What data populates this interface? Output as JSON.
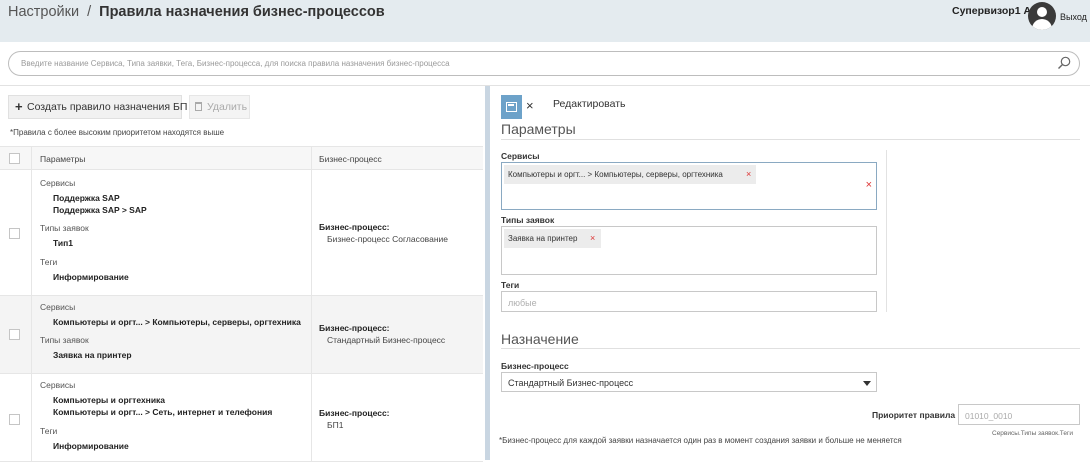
{
  "header": {
    "breadcrumb_root": "Настройки",
    "breadcrumb_sep": "/",
    "title": "Правила  назначения бизнес-процессов",
    "user": "Супервизор1 А.",
    "logout": "Выход"
  },
  "search": {
    "placeholder": "Введите название Сервиса, Типа заявки, Тега, Бизнес-процесса, для поиска правила назначения бизнес-процесса"
  },
  "toolbar": {
    "create_label": "Создать правило назначения БП",
    "delete_label": "Удалить",
    "priority_note": "*Правила с более высоким приоритетом находятся выше"
  },
  "table": {
    "col_params": "Параметры",
    "col_bp": "Бизнес-процесс",
    "rows": [
      {
        "services_label": "Сервисы",
        "services": [
          "Поддержка SAP",
          "Поддержка SAP > SAP"
        ],
        "types_label": "Типы заявок",
        "types": [
          "Тип1"
        ],
        "tags_label": "Теги",
        "tags": [
          "Информирование"
        ],
        "bp_label": "Бизнес-процесс:",
        "bp_value": "Бизнес-процесс Согласование"
      },
      {
        "services_label": "Сервисы",
        "services": [
          "Компьютеры и оргт... > Компьютеры, серверы, оргтехника"
        ],
        "types_label": "Типы заявок",
        "types": [
          "Заявка на принтер"
        ],
        "bp_label": "Бизнес-процесс:",
        "bp_value": "Стандартный Бизнес-процесс"
      },
      {
        "services_label": "Сервисы",
        "services": [
          "Компьютеры и оргтехника",
          "Компьютеры и оргт... > Сеть, интернет и телефония"
        ],
        "tags_label": "Теги",
        "tags": [
          "Информирование"
        ],
        "bp_label": "Бизнес-процесс:",
        "bp_value": "БП1"
      }
    ]
  },
  "editor": {
    "close": "×",
    "edit_label": "Редактировать",
    "params_title": "Параметры",
    "services_label": "Сервисы",
    "services_chip": "Компьютеры и оргт... > Компьютеры, серверы, оргтехника",
    "chip_remove": "×",
    "clear_all": "×",
    "types_label": "Типы заявок",
    "types_chip": "Заявка на принтер",
    "tags_label": "Теги",
    "tags_placeholder": "любые",
    "assign_title": "Назначение",
    "bp_label": "Бизнес-процесс",
    "bp_value": "Стандартный Бизнес-процесс",
    "priority_label": "Приоритет правила",
    "priority_value": "01010_0010",
    "priority_hint": "Сервисы.Типы заявок.Теги",
    "note": "*Бизнес-процесс для каждой заявки назначается один раз в момент создания заявки и больше не меняется"
  }
}
